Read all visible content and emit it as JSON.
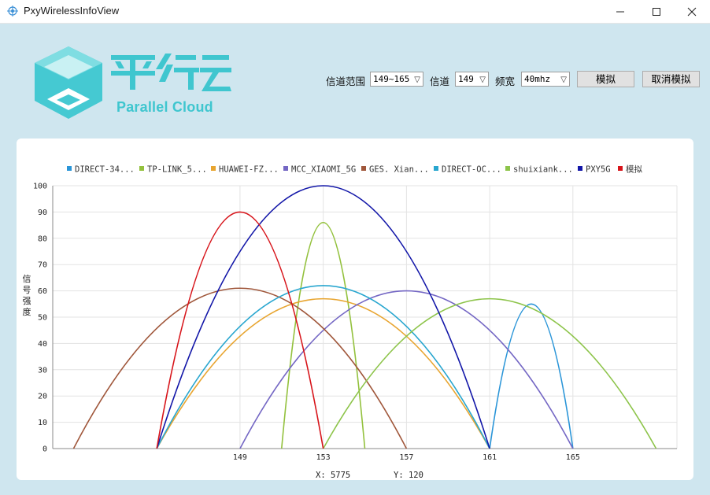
{
  "window": {
    "title": "PxyWirelessInfoView"
  },
  "logo": {
    "brand_text": "Parallel Cloud",
    "brand_cn": "平行云"
  },
  "controls": {
    "channel_range_label": "信道范围",
    "channel_range_value": "149~165",
    "channel_label": "信道",
    "channel_value": "149",
    "bandwidth_label": "频宽",
    "bandwidth_value": "40mhz",
    "simulate_button": "模拟",
    "cancel_simulate_button": "取消模拟"
  },
  "chart_data": {
    "type": "line",
    "ylabel": "信号强度",
    "ylim": [
      0,
      100
    ],
    "yticks": [
      0,
      10,
      20,
      30,
      40,
      50,
      60,
      70,
      80,
      90,
      100
    ],
    "xlim": [
      140,
      170
    ],
    "xticks": [
      149,
      153,
      157,
      161,
      165
    ],
    "series": [
      {
        "name": "DIRECT-34...",
        "color": "#2a95d8",
        "start": 161,
        "peak": 55,
        "end": 165
      },
      {
        "name": "TP-LINK_5...",
        "color": "#93c13d",
        "start": 151,
        "peak": 86,
        "end": 155
      },
      {
        "name": "HUAWEI-FZ...",
        "color": "#e8a530",
        "start": 145,
        "peak": 57,
        "end": 161
      },
      {
        "name": "MCC_XIAOMI_5G",
        "color": "#7467c4",
        "start": 149,
        "peak": 60,
        "end": 165
      },
      {
        "name": "GES. Xian...",
        "color": "#a0573b",
        "start": 141,
        "peak": 61,
        "end": 157
      },
      {
        "name": "DIRECT-OC...",
        "color": "#28a6cf",
        "start": 145,
        "peak": 62,
        "end": 161
      },
      {
        "name": "shuixiank...",
        "color": "#8dc44a",
        "start": 153,
        "peak": 57,
        "end": 169
      },
      {
        "name": "PXY5G",
        "color": "#1216a8",
        "start": 145,
        "peak": 100,
        "end": 161
      },
      {
        "name": "模拟",
        "color": "#d7141a",
        "start": 145,
        "peak": 90,
        "end": 153
      }
    ]
  },
  "status": {
    "x_readout": "X: 5775",
    "y_readout": "Y: 120"
  }
}
